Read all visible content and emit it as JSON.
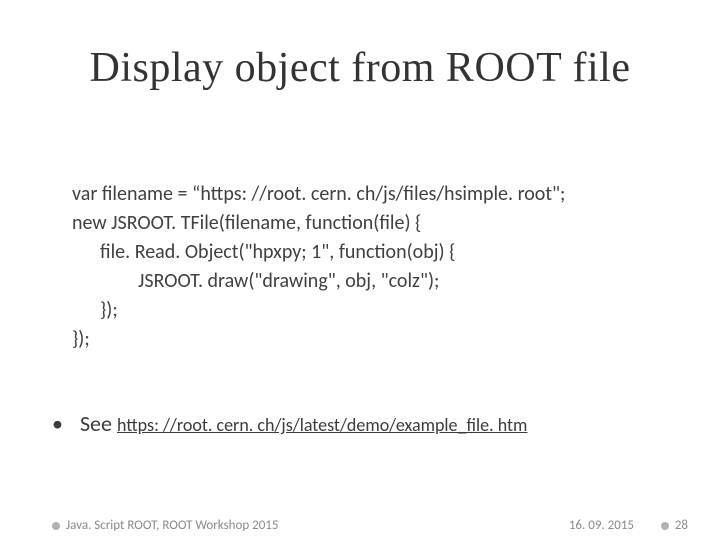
{
  "title": "Display object from ROOT file",
  "code": {
    "l1": "var filename = “https: //root. cern. ch/js/files/hsimple. root\";",
    "l2": "new JSROOT. TFile(filename, function(file) {",
    "l3": "file. Read. Object(\"hpxpy; 1\", function(obj) {",
    "l4": "JSROOT. draw(\"drawing\", obj, \"colz\");",
    "l5": "});",
    "l6": "});"
  },
  "see": {
    "label": "See",
    "link": "https: //root. cern. ch/js/latest/demo/example_file. htm"
  },
  "footer": {
    "left": "Java. Script ROOT, ROOT Workshop 2015",
    "date": "16. 09. 2015",
    "page": "28"
  }
}
